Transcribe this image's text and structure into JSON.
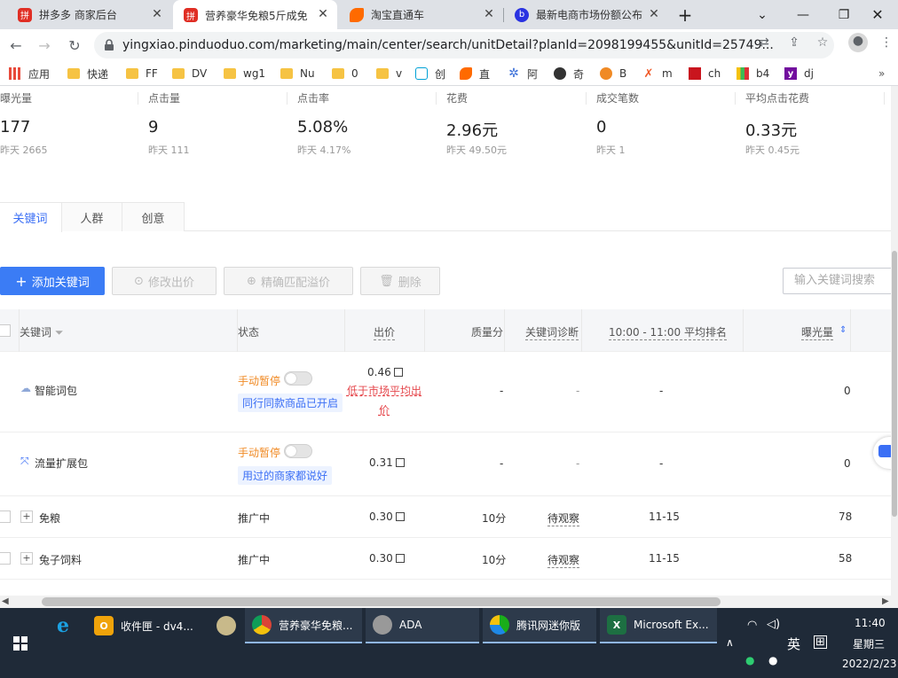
{
  "browser": {
    "tabs": [
      {
        "title": "拼多多 商家后台",
        "active": false
      },
      {
        "title": "营养豪华免粮5斤成免",
        "active": true
      },
      {
        "title": "淘宝直通车",
        "active": false
      },
      {
        "title": "最新电商市场份额公布",
        "active": false
      }
    ],
    "new_tab": "+",
    "url": "yingxiao.pinduoduo.com/marketing/main/center/search/unitDetail?planId=2098199455&unitId=25749...",
    "bookmarks": [
      "应用",
      "快递",
      "FF",
      "DV",
      "wg1",
      "Nu",
      "0",
      "v",
      "创",
      "直",
      "阿",
      "奇",
      "B",
      "m",
      "ch",
      "b4",
      "dj"
    ]
  },
  "metrics": [
    {
      "label": "曝光量",
      "value": "177",
      "yesterday": "昨天 2665"
    },
    {
      "label": "点击量",
      "value": "9",
      "yesterday": "昨天 111"
    },
    {
      "label": "点击率",
      "value": "5.08%",
      "yesterday": "昨天 4.17%"
    },
    {
      "label": "花费",
      "value": "2.96元",
      "yesterday": "昨天 49.50元"
    },
    {
      "label": "成交笔数",
      "value": "0",
      "yesterday": "昨天 1"
    },
    {
      "label": "平均点击花费",
      "value": "0.33元",
      "yesterday": "昨天 0.45元"
    }
  ],
  "subtabs": [
    "关键词",
    "人群",
    "创意"
  ],
  "actions": {
    "add": "添加关键词",
    "modify_bid": "修改出价",
    "precise": "精确匹配溢价",
    "delete": "删除",
    "search_placeholder": "输入关键词搜索"
  },
  "table": {
    "headers": {
      "keyword": "关键词",
      "status": "状态",
      "bid": "出价",
      "quality": "质量分",
      "diagnosis": "关键词诊断",
      "rank": "10:00 - 11:00 平均排名",
      "exposure": "曝光量"
    },
    "rows": [
      {
        "keyword": "智能词包",
        "status": "手动暂停",
        "tag": "同行同款商品已开启",
        "bid": "0.46",
        "warn": "低于市场平均出价",
        "quality": "-",
        "diagnosis": "-",
        "rank": "-",
        "exposure": "0"
      },
      {
        "keyword": "流量扩展包",
        "status": "手动暂停",
        "tag": "用过的商家都说好",
        "bid": "0.31",
        "quality": "-",
        "diagnosis": "-",
        "rank": "-",
        "exposure": "0"
      },
      {
        "keyword": "免粮",
        "status": "推广中",
        "bid": "0.30",
        "quality": "10分",
        "diagnosis": "待观察",
        "rank": "11-15",
        "exposure": "78"
      },
      {
        "keyword": "兔子饲料",
        "status": "推广中",
        "bid": "0.30",
        "quality": "10分",
        "diagnosis": "待观察",
        "rank": "11-15",
        "exposure": "58"
      }
    ]
  },
  "taskbar": {
    "apps": [
      {
        "label": "收件匣 - dv4...",
        "running": false
      },
      {
        "label": "营养豪华免粮...",
        "running": true
      },
      {
        "label": "ADA",
        "running": true
      },
      {
        "label": "腾讯网迷你版",
        "running": true
      },
      {
        "label": "Microsoft Ex...",
        "running": true
      }
    ],
    "ime_lang": "英",
    "time": "11:40",
    "weekday": "星期三",
    "date": "2022/2/23"
  }
}
